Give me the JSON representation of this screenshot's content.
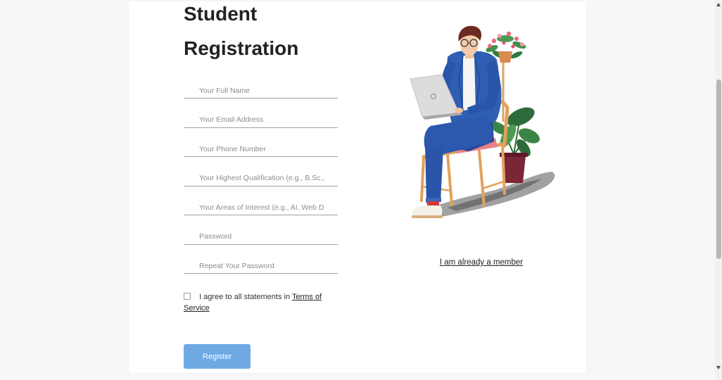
{
  "heading": "Student Registration",
  "form": {
    "fields": [
      {
        "placeholder": "Your Full Name",
        "value": ""
      },
      {
        "placeholder": "Your Email Address",
        "value": ""
      },
      {
        "placeholder": "Your Phone Number",
        "value": ""
      },
      {
        "placeholder": "Your Highest Qualification (e.g., B.Sc.,",
        "value": ""
      },
      {
        "placeholder": "Your Areas of Interest (e.g., AI, Web D",
        "value": ""
      },
      {
        "placeholder": "Password",
        "value": ""
      },
      {
        "placeholder": "Repeat Your Password",
        "value": ""
      }
    ],
    "agree": {
      "checked": false,
      "text": "I agree to all statements in",
      "link": "Terms of Service"
    },
    "submit_label": "Register"
  },
  "aside": {
    "illustration": "person-with-laptop-on-chair-illustration",
    "member_link": "I am already a member"
  },
  "scrollbar": {
    "up_icon": "scroll-up-arrow-icon",
    "down_icon": "scroll-down-arrow-icon"
  },
  "colors": {
    "page_bg": "#f7f7f7",
    "card_bg": "#ffffff",
    "text_dark": "#222222",
    "placeholder": "#8c8c8c",
    "underline": "#a0a0a0",
    "button_bg": "#6ea9e4",
    "button_text": "#ffffff"
  }
}
